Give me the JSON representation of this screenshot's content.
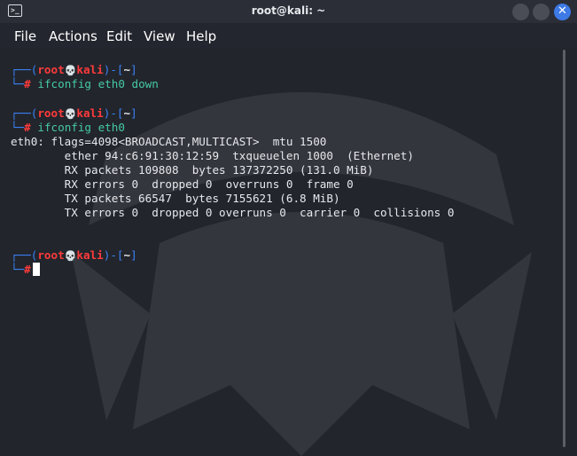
{
  "window": {
    "title": "root@kali: ~",
    "app_icon_glyph": ">_",
    "minimize_glyph": "",
    "maximize_glyph": "",
    "close_glyph": "✕",
    "accent_color": "#3d7ae6"
  },
  "menu": {
    "file": "File",
    "actions": "Actions",
    "edit": "Edit",
    "view": "View",
    "help": "Help"
  },
  "prompt": {
    "top_left": "┌──(",
    "user": "root",
    "skull": "💀",
    "host": "kali",
    "mid": ")-[",
    "cwd": "~",
    "end": "]",
    "bottom_left": "└─",
    "hash": "#"
  },
  "commands": [
    "ifconfig eth0 down",
    "ifconfig eth0"
  ],
  "output": [
    "eth0: flags=4098<BROADCAST,MULTICAST>  mtu 1500",
    "        ether 94:c6:91:30:12:59  txqueuelen 1000  (Ethernet)",
    "        RX packets 109808  bytes 137372250 (131.0 MiB)",
    "        RX errors 0  dropped 0  overruns 0  frame 0",
    "        TX packets 66547  bytes 7155621 (6.8 MiB)",
    "        TX errors 0  dropped 0 overruns 0  carrier 0  collisions 0"
  ],
  "colors": {
    "prompt_frame": "#3b82f6",
    "prompt_user": "#ff3b3b",
    "command": "#46c9a4"
  }
}
